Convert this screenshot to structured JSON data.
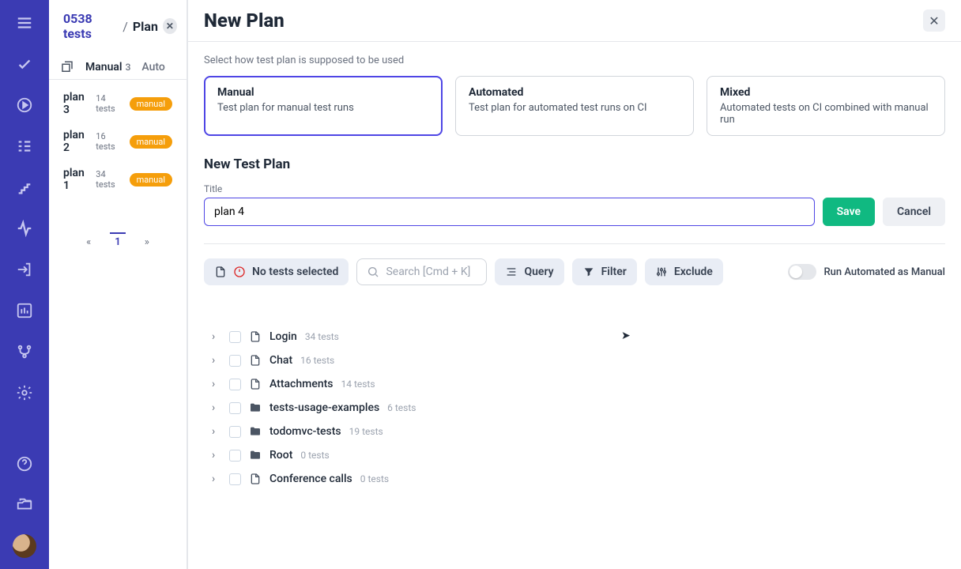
{
  "breadcrumb": {
    "project": "0538 tests",
    "section": "Plan"
  },
  "left_tabs": {
    "manual_label": "Manual",
    "manual_count": "3",
    "automatic_label": "Auto"
  },
  "plans": [
    {
      "name": "plan 3",
      "count": "14 tests",
      "badge": "manual"
    },
    {
      "name": "plan 2",
      "count": "16 tests",
      "badge": "manual"
    },
    {
      "name": "plan 1",
      "count": "34 tests",
      "badge": "manual"
    }
  ],
  "pager": {
    "prev": "«",
    "current": "1",
    "next": "»"
  },
  "modal": {
    "title": "New Plan",
    "hint": "Select how test plan is supposed to be used",
    "types": [
      {
        "title": "Manual",
        "desc": "Test plan for manual test runs"
      },
      {
        "title": "Automated",
        "desc": "Test plan for automated test runs on CI"
      },
      {
        "title": "Mixed",
        "desc": "Automated tests on CI combined with manual run"
      }
    ],
    "section_title": "New Test Plan",
    "title_label": "Title",
    "title_value": "plan 4",
    "save_label": "Save",
    "cancel_label": "Cancel",
    "no_tests_label": "No tests selected",
    "search_placeholder": "Search [Cmd + K]",
    "query_label": "Query",
    "filter_label": "Filter",
    "exclude_label": "Exclude",
    "toggle_label": "Run Automated as Manual"
  },
  "tree": [
    {
      "icon": "file",
      "name": "Login",
      "count": "34 tests"
    },
    {
      "icon": "file",
      "name": "Chat",
      "count": "16 tests"
    },
    {
      "icon": "file",
      "name": "Attachments",
      "count": "14 tests"
    },
    {
      "icon": "folder",
      "name": "tests-usage-examples",
      "count": "6 tests"
    },
    {
      "icon": "folder",
      "name": "todomvc-tests",
      "count": "19 tests"
    },
    {
      "icon": "folder",
      "name": "Root",
      "count": "0 tests"
    },
    {
      "icon": "file",
      "name": "Conference calls",
      "count": "0 tests"
    }
  ]
}
